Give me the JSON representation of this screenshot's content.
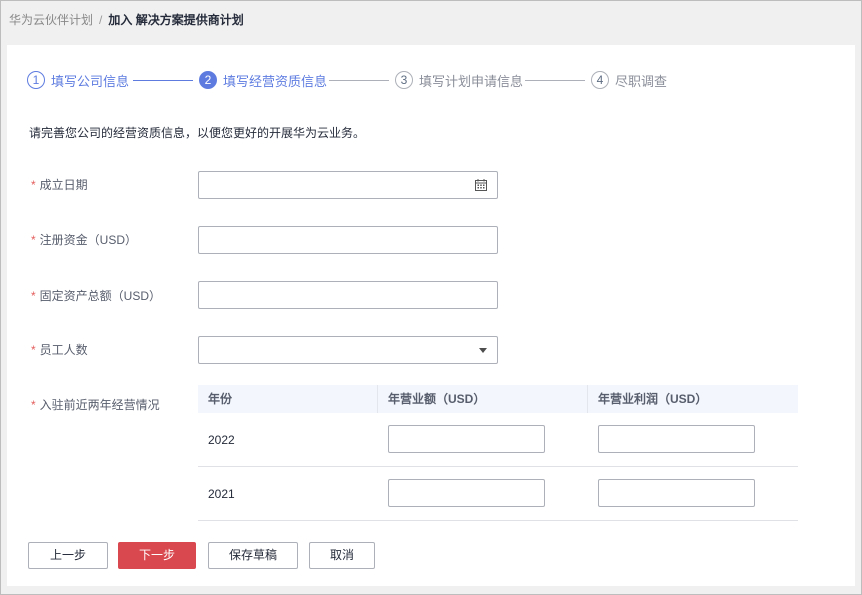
{
  "breadcrumb": {
    "parent": "华为云伙伴计划",
    "separator": "/",
    "current": "加入 解决方案提供商计划"
  },
  "steps": [
    {
      "num": "1",
      "label": "填写公司信息",
      "state": "done"
    },
    {
      "num": "2",
      "label": "填写经营资质信息",
      "state": "active"
    },
    {
      "num": "3",
      "label": "填写计划申请信息",
      "state": "pending"
    },
    {
      "num": "4",
      "label": "尽职调查",
      "state": "pending"
    }
  ],
  "description": "请完善您公司的经营资质信息，以便您更好的开展华为云业务。",
  "form": {
    "required_mark": "*",
    "founded_date": {
      "label": "成立日期",
      "value": ""
    },
    "registered_capital": {
      "label": "注册资金（USD）",
      "value": ""
    },
    "fixed_assets": {
      "label": "固定资产总额（USD）",
      "value": ""
    },
    "employees": {
      "label": "员工人数",
      "value": ""
    },
    "history": {
      "label": "入驻前近两年经营情况",
      "headers": [
        "年份",
        "年营业额（USD）",
        "年营业利润（USD）"
      ],
      "rows": [
        {
          "year": "2022",
          "revenue": "",
          "profit": ""
        },
        {
          "year": "2021",
          "revenue": "",
          "profit": ""
        }
      ]
    }
  },
  "buttons": {
    "prev": "上一步",
    "next": "下一步",
    "save_draft": "保存草稿",
    "cancel": "取消"
  },
  "colors": {
    "accent": "#5e7ce0",
    "primary_button": "#d9474f",
    "required": "#e45d5d"
  },
  "icons": {
    "date": "calendar-icon",
    "select": "caret-down-icon"
  }
}
